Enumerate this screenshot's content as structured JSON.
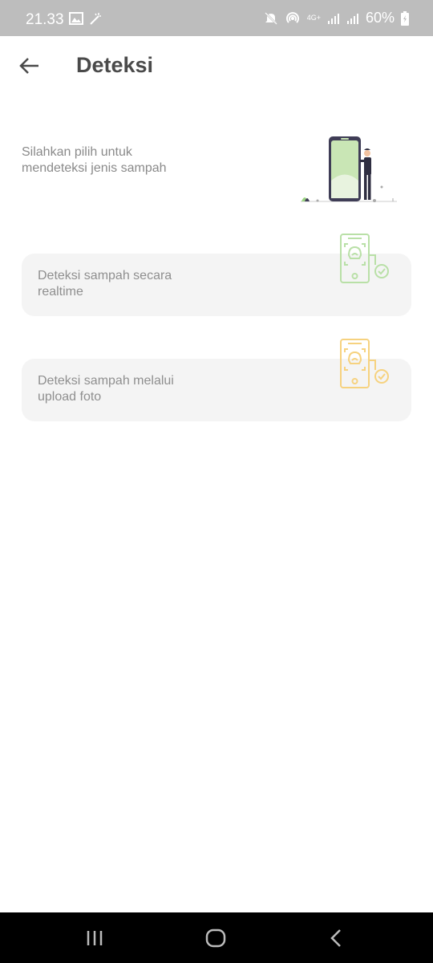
{
  "status_bar": {
    "time": "21.33",
    "network": "4G+",
    "battery": "60%",
    "icons": [
      "image-icon",
      "magic-wand-icon",
      "mute-icon",
      "hotspot-icon",
      "signal-icon",
      "signal-icon",
      "battery-icon"
    ]
  },
  "app_bar": {
    "title": "Deteksi",
    "back_icon": "arrow-left-icon"
  },
  "intro": {
    "text": "Silahkan pilih untuk mendeteksi jenis sampah"
  },
  "options": [
    {
      "label": "Deteksi sampah secara realtime",
      "icon": "phone-scan-check-icon",
      "color": "#b9e0a7"
    },
    {
      "label": "Deteksi sampah melalui upload foto",
      "icon": "phone-scan-check-icon",
      "color": "#f6d27f"
    }
  ],
  "nav_bar": {
    "icons": [
      "recent-apps-icon",
      "home-icon",
      "back-icon"
    ]
  },
  "colors": {
    "status_bar_bg": "#bdbdbd",
    "card_bg": "#f4f4f4",
    "title": "#4a4a4a",
    "muted_text": "#8a8a8a"
  }
}
